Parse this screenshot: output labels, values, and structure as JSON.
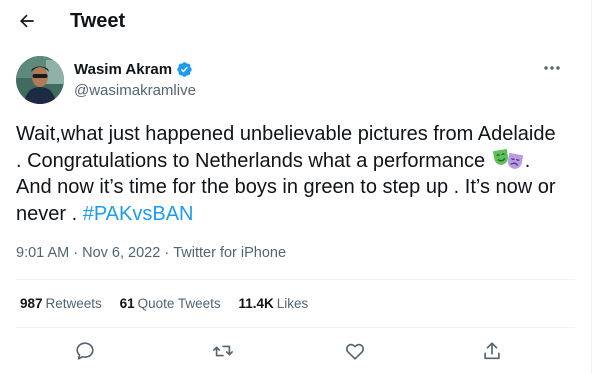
{
  "header": {
    "title": "Tweet",
    "back_icon": "arrow-left-icon"
  },
  "author": {
    "display_name": "Wasim Akram",
    "handle": "@wasimakramlive",
    "verified": true,
    "verified_color": "#1d9bf0"
  },
  "tweet": {
    "text_part1": "Wait,what just happened unbelievable pictures from Adelaide . Congratulations to Netherlands what a performance ",
    "emoji": "performing-arts-emoji",
    "text_part2": ". And now it’s time for the boys in green to step up . It’s now or never . ",
    "hashtag": "#PAKvsBAN",
    "link_color": "#1d9bf0"
  },
  "meta": {
    "time": "9:01 AM",
    "separator": "·",
    "date": "Nov 6, 2022",
    "source": "Twitter for iPhone"
  },
  "stats": {
    "retweets_count": "987",
    "retweets_label": "Retweets",
    "quotes_count": "61",
    "quotes_label": "Quote Tweets",
    "likes_count": "11.4K",
    "likes_label": "Likes"
  },
  "actions": [
    "reply-icon",
    "retweet-icon",
    "like-icon",
    "share-icon"
  ]
}
